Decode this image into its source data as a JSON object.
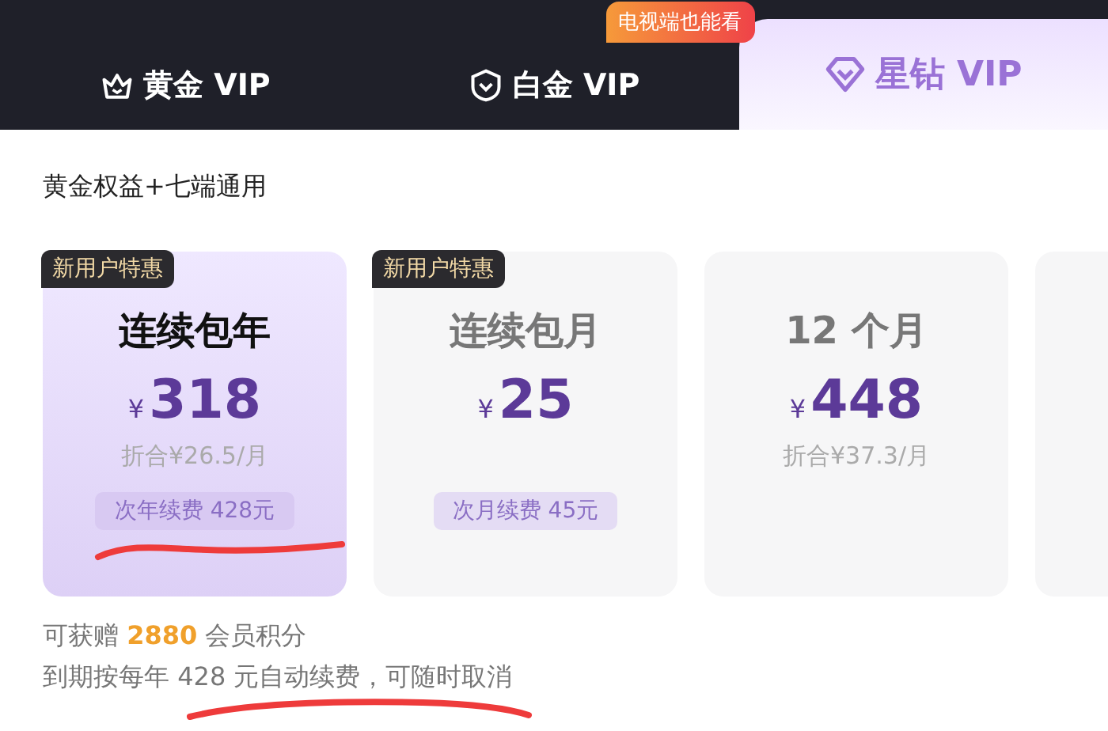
{
  "tabs": [
    {
      "label": "黄金 VIP",
      "kind": "crown",
      "selected": false
    },
    {
      "label": "白金 VIP",
      "kind": "shield",
      "selected": false,
      "badge": "电视端也能看"
    },
    {
      "label": "星钻 VIP",
      "kind": "diamond",
      "selected": true
    }
  ],
  "subtitle": "黄金权益+七端通用",
  "plans": [
    {
      "selected": true,
      "badge": "新用户特惠",
      "title": "连续包年",
      "currency": "¥",
      "price": "318",
      "per_month": "折合¥26.5/月",
      "renewal": "次年续费 428元"
    },
    {
      "selected": false,
      "badge": "新用户特惠",
      "title": "连续包月",
      "currency": "¥",
      "price": "25",
      "renewal": "次月续费 45元"
    },
    {
      "selected": false,
      "title": "12 个月",
      "currency": "¥",
      "price": "448",
      "per_month": "折合¥37.3/月"
    },
    {
      "selected": false
    }
  ],
  "notes": [
    "可获赠 **2880** 会员积分",
    "到期按每年 428 元自动续费，可随时取消"
  ]
}
